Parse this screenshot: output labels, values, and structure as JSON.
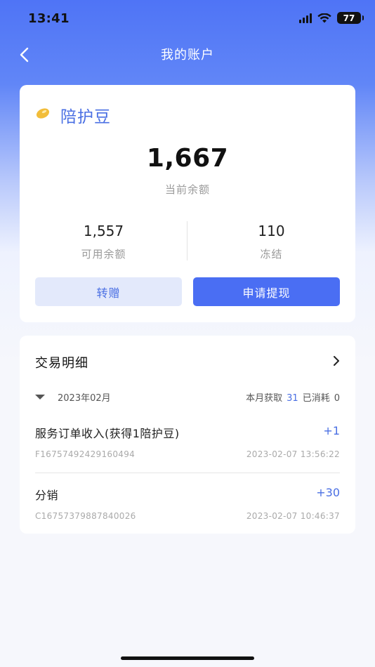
{
  "status_bar": {
    "time": "13:41",
    "battery_level": "77",
    "icons": [
      "signal-icon",
      "wifi-icon",
      "battery-icon"
    ]
  },
  "nav": {
    "title": "我的账户",
    "back_icon": "chevron-left-icon"
  },
  "account": {
    "icon": "bean-icon",
    "title": "陪护豆",
    "balance": "1,667",
    "balance_label": "当前余额",
    "available_value": "1,557",
    "available_label": "可用余额",
    "frozen_value": "110",
    "frozen_label": "冻结",
    "transfer_label": "转赠",
    "withdraw_label": "申请提现"
  },
  "details": {
    "title": "交易明细",
    "chevron_icon": "chevron-right-icon",
    "month": "2023年02月",
    "earned_label": "本月获取",
    "earned_value": "31",
    "spent_label": "已消耗",
    "spent_value": "0",
    "transactions": [
      {
        "name": "服务订单收入(获得1陪护豆)",
        "amount": "+1",
        "code": "F16757492429160494",
        "time": "2023-02-07 13:56:22"
      },
      {
        "name": "分销",
        "amount": "+30",
        "code": "C16757379887840026",
        "time": "2023-02-07 10:46:37"
      }
    ]
  },
  "colors": {
    "accent": "#4a6ef3",
    "accent_light": "#e3e9fb",
    "header_gradient_top": "#4f74f6"
  }
}
